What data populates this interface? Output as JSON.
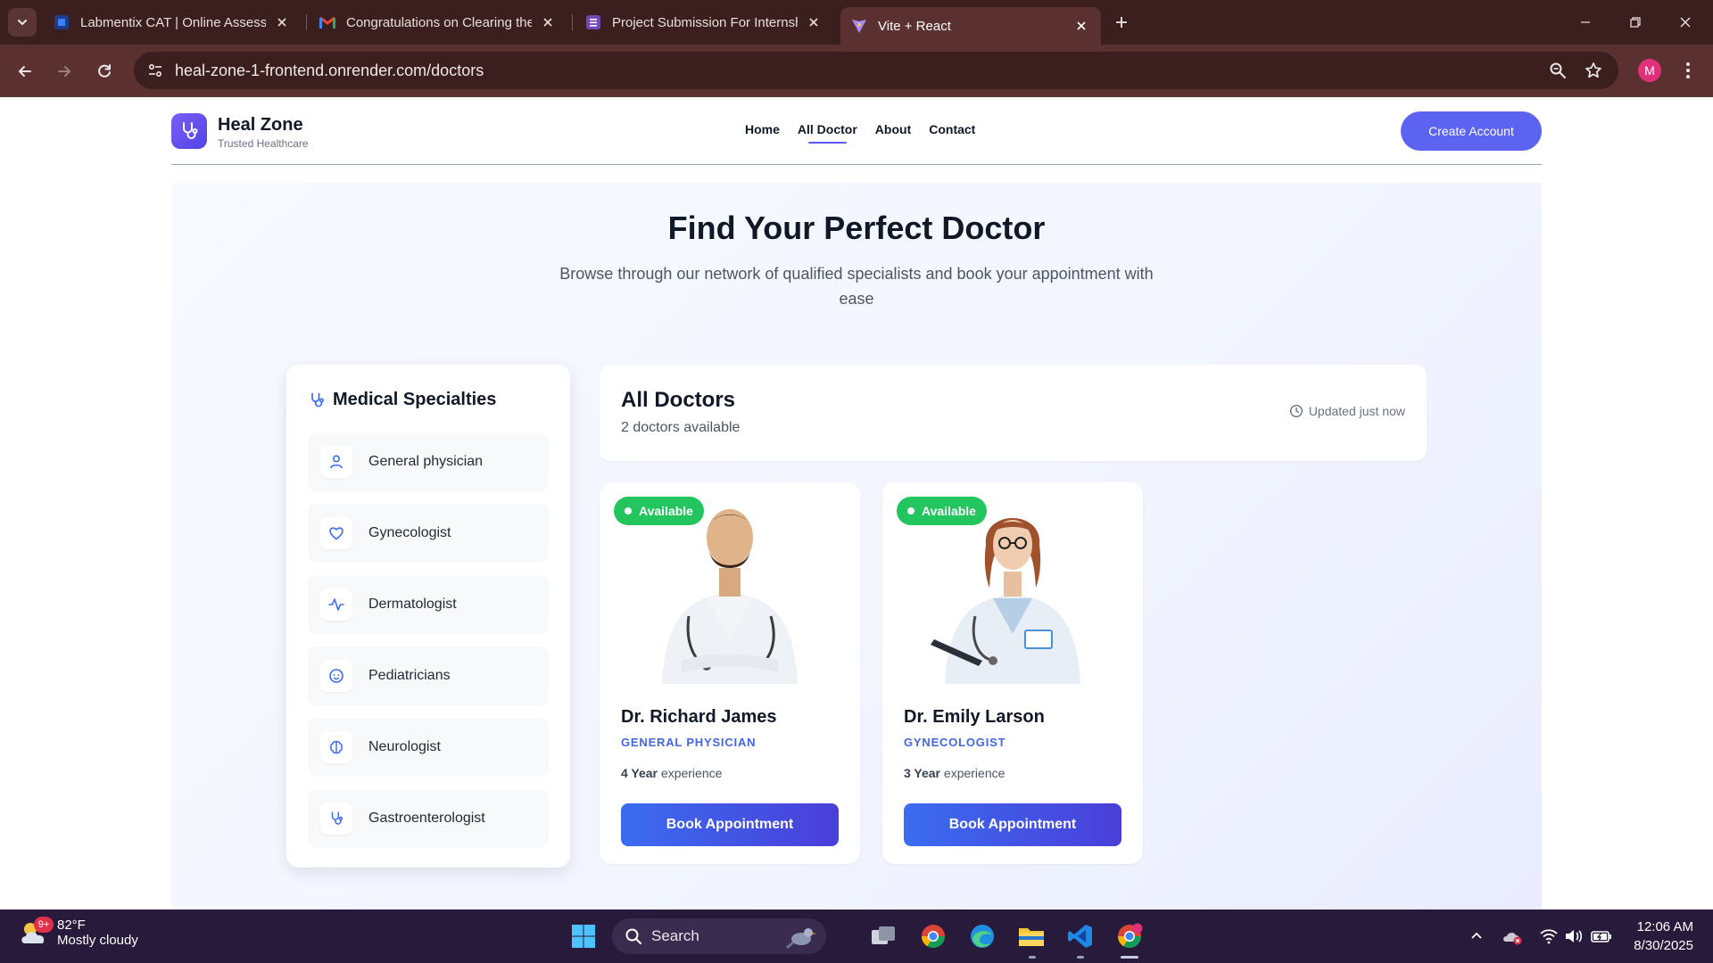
{
  "browser": {
    "tabs": [
      {
        "title": "Labmentix CAT | Online Assessm"
      },
      {
        "title": "Congratulations on Clearing the"
      },
      {
        "title": "Project Submission For Internsh"
      },
      {
        "title": "Vite + React"
      }
    ],
    "url": "heal-zone-1-frontend.onrender.com/doctors",
    "profile_initial": "M"
  },
  "site": {
    "brand": {
      "name": "Heal Zone",
      "tagline": "Trusted Healthcare"
    },
    "nav": [
      {
        "label": "Home"
      },
      {
        "label": "All Doctor"
      },
      {
        "label": "About"
      },
      {
        "label": "Contact"
      }
    ],
    "create_account": "Create Account",
    "hero": {
      "title": "Find Your Perfect Doctor",
      "subtitle": "Browse through our network of qualified specialists and book your appointment with ease"
    },
    "specialties": {
      "title": "Medical Specialties",
      "items": [
        {
          "label": "General physician",
          "icon": "person-icon"
        },
        {
          "label": "Gynecologist",
          "icon": "heart-icon"
        },
        {
          "label": "Dermatologist",
          "icon": "pulse-icon"
        },
        {
          "label": "Pediatricians",
          "icon": "baby-icon"
        },
        {
          "label": "Neurologist",
          "icon": "brain-icon"
        },
        {
          "label": "Gastroenterologist",
          "icon": "stethoscope-icon"
        }
      ]
    },
    "doctors_header": {
      "title": "All Doctors",
      "count": "2 doctors available",
      "updated": "Updated just now"
    },
    "doctors": [
      {
        "name": "Dr. Richard James",
        "specialty": "GENERAL PHYSICIAN",
        "exp_years": "4 Year",
        "exp_label": "experience",
        "badge": "Available",
        "book": "Book Appointment"
      },
      {
        "name": "Dr. Emily Larson",
        "specialty": "GYNECOLOGIST",
        "exp_years": "3 Year",
        "exp_label": "experience",
        "badge": "Available",
        "book": "Book Appointment"
      }
    ]
  },
  "taskbar": {
    "weather_temp": "82°F",
    "weather_cond": "Mostly cloudy",
    "weather_badge": "9+",
    "search": "Search",
    "time": "12:06 AM",
    "date": "8/30/2025"
  },
  "colors": {
    "accent": "#5b63f0",
    "available": "#22c55e",
    "specialty_text": "#4466e0",
    "chrome": "#3b1f1f",
    "taskbar": "#271a3a"
  }
}
